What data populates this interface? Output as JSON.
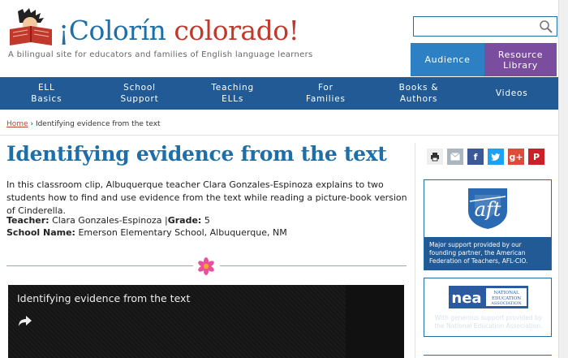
{
  "header": {
    "logo_part1": "¡Colorín",
    "logo_part2": "colorado!",
    "tagline": "A bilingual site for educators and families of English language learners",
    "search_placeholder": "",
    "audience_label": "Audience",
    "resource_label": "Resource\nLibrary"
  },
  "nav": {
    "items": [
      {
        "label": "ELL\nBasics"
      },
      {
        "label": "School\nSupport"
      },
      {
        "label": "Teaching\nELLs"
      },
      {
        "label": "For\nFamilies"
      },
      {
        "label": "Books &\nAuthors"
      },
      {
        "label": "Videos"
      }
    ]
  },
  "breadcrumb": {
    "home": "Home",
    "separator": "›",
    "current": "Identifying evidence from the text"
  },
  "article": {
    "title": "Identifying evidence from the text",
    "intro": "In this classroom clip, Albuquerque teacher Clara Gonzales-Espinoza explains to two students how to find and use evidence from the text while reading a picture-book version of Cinderella.",
    "teacher_label": "Teacher:",
    "teacher_value": "Clara Gonzales-Espinoza",
    "grade_sep": "|",
    "grade_label": "Grade:",
    "grade_value": "5",
    "school_label": "School Name:",
    "school_value": "Emerson Elementary School, Albuquerque, NM"
  },
  "video": {
    "title": "Identifying evidence from the text"
  },
  "sidebar": {
    "aft_text": "Major support provided by our founding partner, the American Federation of Teachers, AFL-CIO.",
    "nea_logo_word": "nea",
    "nea_logo_sub1": "NATIONAL",
    "nea_logo_sub2": "EDUCATION",
    "nea_logo_sub3": "ASSOCIATION",
    "nea_text": "With generous support provided by the National Education Association."
  },
  "colors": {
    "brand_blue": "#1e6fa8",
    "nav_blue": "#215a95",
    "audience_blue": "#2d80c4",
    "resource_purple": "#7a4d9e",
    "logo_red": "#c0392b"
  }
}
